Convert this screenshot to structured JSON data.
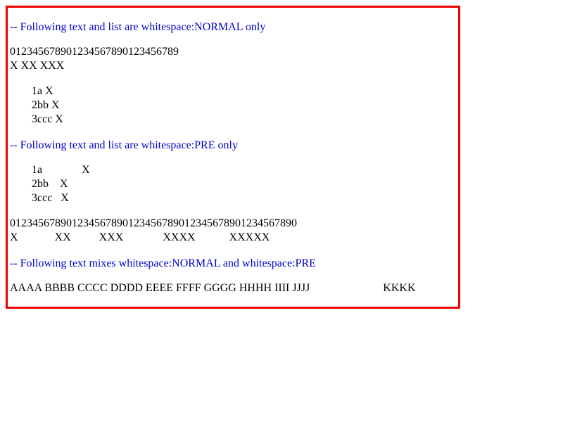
{
  "headings": {
    "normal": "-- Following text and list are whitespace:NORMAL only",
    "pre": "-- Following text and list are whitespace:PRE only",
    "mixed": "-- Following text mixes whitespace:NORMAL and whitespace:PRE"
  },
  "normal_section": {
    "digits": "012345678901234567890123456789",
    "xs": "X XX XXX",
    "list": [
      {
        "marker": "1.",
        "text": "a X"
      },
      {
        "marker": "2.",
        "text": "bb X"
      },
      {
        "marker": "3.",
        "text": "ccc X"
      }
    ]
  },
  "pre_section": {
    "list": [
      {
        "marker": "1.",
        "text": "a              X"
      },
      {
        "marker": "2.",
        "text": "bb    X"
      },
      {
        "marker": "3.",
        "text": "ccc   X"
      }
    ],
    "digits": "012345678901234567890123456789012345678901234567890",
    "xs": "X             XX          XXX              XXXX            XXXXX"
  },
  "mixed_section": {
    "normal_part": "AAAA BBBB CCCC DDDD EEEE FFFF GGGG HHHH IIII JJJJ",
    "pre_part": "                          KKKK"
  }
}
